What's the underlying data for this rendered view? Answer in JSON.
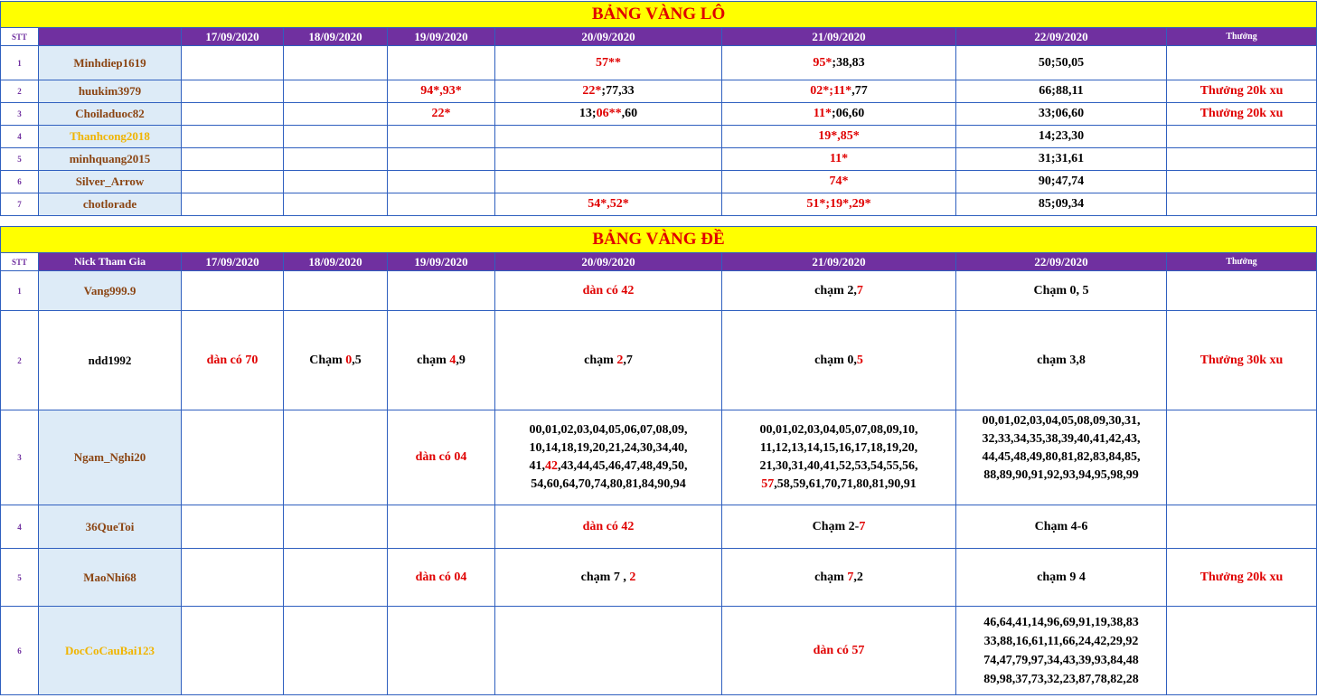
{
  "lo": {
    "title": "BẢNG VÀNG LÔ",
    "headers": [
      "STT",
      "",
      "17/09/2020",
      "18/09/2020",
      "19/09/2020",
      "20/09/2020",
      "21/09/2020",
      "22/09/2020",
      "Thưởng"
    ],
    "rows": [
      {
        "stt": "1",
        "nick": "Minhdiep1619",
        "d17": "",
        "d18": "",
        "d19": "",
        "d20": "57**",
        "d21a": "95*",
        "d21b": ";38,83",
        "d22": "50;50,05",
        "reward": ""
      },
      {
        "stt": "2",
        "nick": "huukim3979",
        "d17": "",
        "d18": "",
        "d19": "94*,93*",
        "d20a": "22*",
        "d20b": ";77,33",
        "d21a": "02*;11*",
        "d21b": ",77",
        "d22": "66;88,11",
        "reward": "Thưởng 20k xu"
      },
      {
        "stt": "3",
        "nick": "Choiladuoc82",
        "d17": "",
        "d18": "",
        "d19": "22*",
        "d20a": "13;",
        "d20b": "06**",
        "d20c": ",60",
        "d21a": "11*",
        "d21b": ";06,60",
        "d22": "33;06,60",
        "reward": "Thưởng 20k xu"
      },
      {
        "stt": "4",
        "nick": "Thanhcong2018",
        "d17": "",
        "d18": "",
        "d19": "",
        "d20": "",
        "d21": "19*,85*",
        "d22": "14;23,30",
        "reward": ""
      },
      {
        "stt": "5",
        "nick": "minhquang2015",
        "d17": "",
        "d18": "",
        "d19": "",
        "d20": "",
        "d21": "11*",
        "d22": "31;31,61",
        "reward": ""
      },
      {
        "stt": "6",
        "nick": "Silver_Arrow",
        "d17": "",
        "d18": "",
        "d19": "",
        "d20": "",
        "d21": "74*",
        "d22": "90;47,74",
        "reward": ""
      },
      {
        "stt": "7",
        "nick": "chotlorade",
        "d17": "",
        "d18": "",
        "d19": "",
        "d20": "54*,52*",
        "d21": "51*;19*,29*",
        "d22": "85;09,34",
        "reward": ""
      }
    ]
  },
  "de": {
    "title": "BẢNG VÀNG ĐỀ",
    "headers": [
      "STT",
      "Nick Tham Gia",
      "17/09/2020",
      "18/09/2020",
      "19/09/2020",
      "20/09/2020",
      "21/09/2020",
      "22/09/2020",
      "Thưởng"
    ],
    "rows": [
      {
        "stt": "1",
        "nick": "Vang999.9",
        "d20": "dàn có 42",
        "d21a": "chạm 2,",
        "d21b": "7",
        "d22": "Chạm 0, 5"
      },
      {
        "stt": "2",
        "nick": "ndd1992",
        "d17": "dàn có 70",
        "d18a": "Chạm ",
        "d18b": "0",
        "d18c": ",5",
        "d19a": "chạm ",
        "d19b": "4",
        "d19c": ",9",
        "d20a": "chạm ",
        "d20b": "2",
        "d20c": ",7",
        "d21a": "chạm 0,",
        "d21b": "5",
        "d22": "chạm 3,8",
        "reward": "Thưởng 30k xu"
      },
      {
        "stt": "3",
        "nick": "Ngam_Nghi20",
        "d19": "dàn có 04",
        "d20_l1": "00,01,02,03,04,05,06,07,08,09,",
        "d20_l2": "10,14,18,19,20,21,24,30,34,40,",
        "d20_l3a": "41,",
        "d20_l3b": "42",
        "d20_l3c": ",43,44,45,46,47,48,49,50,",
        "d20_l4": "54,60,64,70,74,80,81,84,90,94",
        "d21_l1": "00,01,02,03,04,05,07,08,09,10,",
        "d21_l2": "11,12,13,14,15,16,17,18,19,20,",
        "d21_l3": "21,30,31,40,41,52,53,54,55,56,",
        "d21_l4a": "57",
        "d21_l4b": ",58,59,61,70,71,80,81,90,91",
        "d22_l1": "00,01,02,03,04,05,08,09,30,31,",
        "d22_l2": "32,33,34,35,38,39,40,41,42,43,",
        "d22_l3": "44,45,48,49,80,81,82,83,84,85,",
        "d22_l4": "88,89,90,91,92,93,94,95,98,99"
      },
      {
        "stt": "4",
        "nick": "36QueToi",
        "d20": "dàn có 42",
        "d21a": "Chạm 2-",
        "d21b": "7",
        "d22": "Chạm 4-6"
      },
      {
        "stt": "5",
        "nick": "MaoNhi68",
        "d19": "dàn có 04",
        "d20a": "chạm 7 , ",
        "d20b": "2",
        "d21a": "chạm ",
        "d21b": "7",
        "d21c": ",2",
        "d22": "chạm 9 4",
        "reward": "Thưởng 20k xu"
      },
      {
        "stt": "6",
        "nick": "DocCoCauBai123",
        "d21": "dàn có 57",
        "d22_l1": "46,64,41,14,96,69,91,19,38,83",
        "d22_l2": "33,88,16,61,11,66,24,42,29,92",
        "d22_l3": "74,47,79,97,34,43,39,93,84,48",
        "d22_l4": "89,98,37,73,32,23,87,78,82,28"
      }
    ]
  }
}
